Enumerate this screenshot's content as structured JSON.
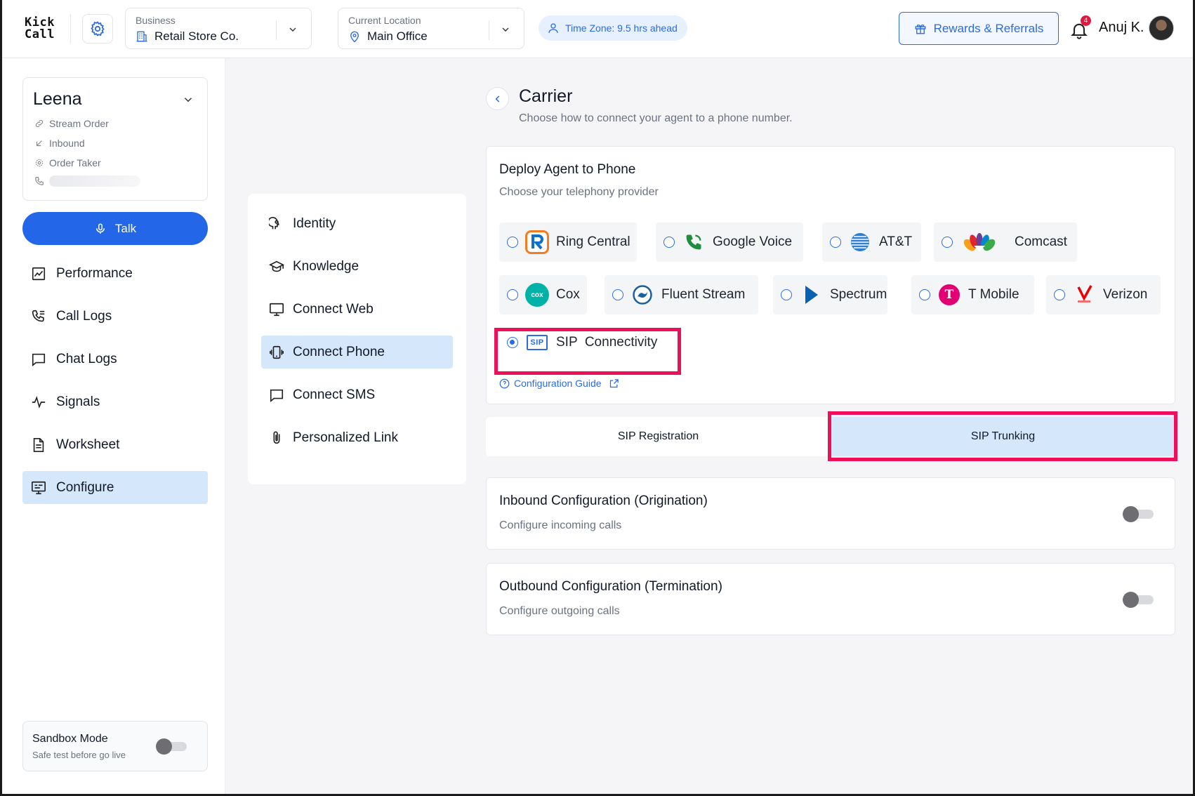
{
  "brand": {
    "line1": "Kick",
    "line2": "Call"
  },
  "topbar": {
    "business": {
      "caption": "Business",
      "value": "Retail Store Co."
    },
    "location": {
      "caption": "Current Location",
      "value": "Main Office"
    },
    "timezone": "Time Zone: 9.5 hrs ahead",
    "rewards_label": "Rewards & Referrals",
    "notification_count": "4",
    "user_name": "Anuj K."
  },
  "agent": {
    "name": "Leena",
    "meta": [
      "Stream Order",
      "Inbound",
      "Order Taker"
    ],
    "talk_label": "Talk"
  },
  "sidebar": {
    "items": [
      {
        "label": "Performance",
        "icon": "chart-icon"
      },
      {
        "label": "Call Logs",
        "icon": "call-log-icon"
      },
      {
        "label": "Chat Logs",
        "icon": "chat-icon"
      },
      {
        "label": "Signals",
        "icon": "pulse-icon"
      },
      {
        "label": "Worksheet",
        "icon": "document-icon"
      },
      {
        "label": "Configure",
        "icon": "monitor-config-icon",
        "active": true
      }
    ],
    "sandbox": {
      "title": "Sandbox Mode",
      "subtitle": "Safe test before go live",
      "enabled": false
    }
  },
  "submenu": {
    "items": [
      {
        "label": "Identity",
        "icon": "head-gear-icon"
      },
      {
        "label": "Knowledge",
        "icon": "graduation-cap-icon"
      },
      {
        "label": "Connect Web",
        "icon": "monitor-icon"
      },
      {
        "label": "Connect Phone",
        "icon": "phone-vibrate-icon",
        "active": true
      },
      {
        "label": "Connect SMS",
        "icon": "message-icon"
      },
      {
        "label": "Personalized Link",
        "icon": "paperclip-icon"
      }
    ]
  },
  "carrier": {
    "title": "Carrier",
    "subtitle": "Choose how to connect your agent to a phone number.",
    "deploy_title": "Deploy Agent to Phone",
    "deploy_subtitle": "Choose your telephony provider",
    "providers": [
      {
        "label": "Ring Central",
        "icon": "ringcentral-logo",
        "selected": false
      },
      {
        "label": "Google Voice",
        "icon": "google-voice-logo",
        "selected": false
      },
      {
        "label": "AT&T",
        "icon": "att-logo",
        "selected": false
      },
      {
        "label": "Comcast",
        "icon": "comcast-logo",
        "selected": false
      },
      {
        "label": "Cox",
        "icon": "cox-logo",
        "selected": false
      },
      {
        "label": "Fluent Stream",
        "icon": "fluent-stream-logo",
        "selected": false
      },
      {
        "label": "Spectrum",
        "icon": "spectrum-logo",
        "selected": false
      },
      {
        "label": "T Mobile",
        "icon": "tmobile-logo",
        "selected": false
      },
      {
        "label": "Verizon",
        "icon": "verizon-logo",
        "selected": false
      },
      {
        "label": "SIP  Connectivity",
        "icon": "sip-logo",
        "selected": true
      }
    ],
    "cox_logo_text": "cox",
    "sip_logo_text": "SIP",
    "tmobile_logo_text": "T",
    "config_guide": "Configuration Guide"
  },
  "sip_tabs": {
    "registration": "SIP Registration",
    "trunking": "SIP Trunking",
    "active": "trunking"
  },
  "inbound": {
    "title": "Inbound Configuration (Origination)",
    "subtitle": "Configure incoming calls",
    "enabled": false
  },
  "outbound": {
    "title": "Outbound Configuration (Termination)",
    "subtitle": "Configure outgoing calls",
    "enabled": false
  },
  "colors": {
    "accent": "#2466e8",
    "active_bg": "#d5e7fb",
    "highlight": "#ee0f5a"
  }
}
